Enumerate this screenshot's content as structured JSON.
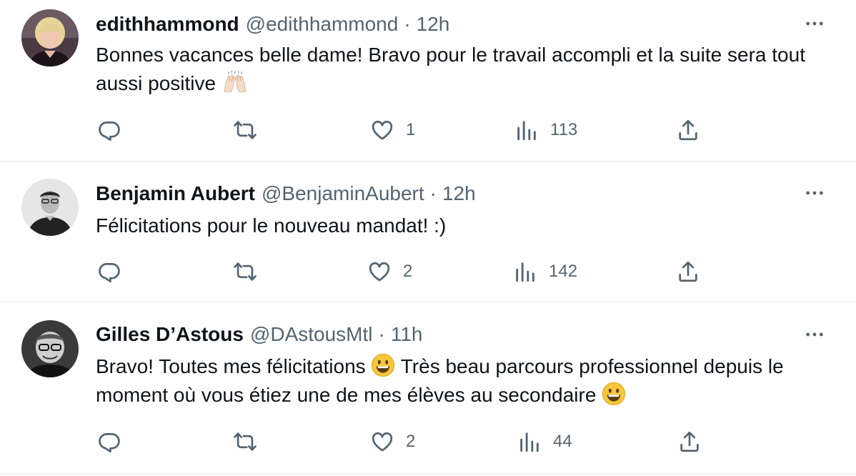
{
  "replies": [
    {
      "name": "edithhammond",
      "handle": "@edithhammond",
      "separator": "·",
      "time": "12h",
      "text": "Bonnes vacances belle dame! Bravo pour le travail accompli et la suite sera tout aussi positive",
      "emoji": "raising-hands",
      "likes": "1",
      "views": "113"
    },
    {
      "name": "Benjamin Aubert",
      "handle": "@BenjaminAubert",
      "separator": "·",
      "time": "12h",
      "text": "Félicitations pour le nouveau mandat! :)",
      "likes": "2",
      "views": "142"
    },
    {
      "name": "Gilles D’Astous",
      "handle": "@DAstousMtl",
      "separator": "·",
      "time": "11h",
      "text_1": "Bravo!  Toutes mes félicitations",
      "text_2": "Très beau parcours professionnel depuis le moment où vous étiez une de mes élèves au secondaire",
      "emoji": "grinning-face",
      "likes": "2",
      "views": "44"
    }
  ],
  "colors": {
    "text": "#0f1419",
    "secondary": "#536471",
    "divider": "#e7e9ea"
  },
  "icons": [
    "reply-icon",
    "retweet-icon",
    "like-icon",
    "views-icon",
    "share-icon",
    "more-icon"
  ]
}
